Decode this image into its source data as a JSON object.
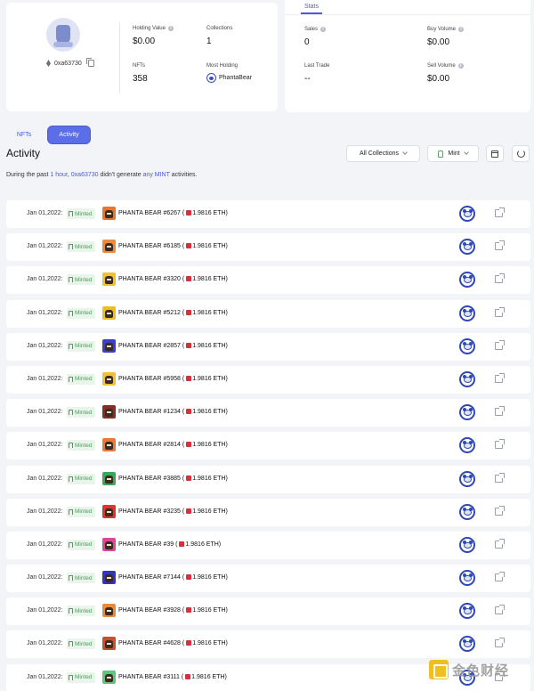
{
  "profile": {
    "address": "0xa63730",
    "holding_value_label": "Holding Value",
    "holding_value": "$0.00",
    "collections_label": "Collections",
    "collections": "1",
    "nfts_label": "NFTs",
    "nfts": "358",
    "most_holding_label": "Most Holding",
    "most_holding": "PhantaBear"
  },
  "stats": {
    "tab_label": "Stats",
    "sales_label": "Sales",
    "sales": "0",
    "buy_volume_label": "Buy Volume",
    "buy_volume": "$0.00",
    "last_trade_label": "Last Trade",
    "last_trade": "--",
    "sell_volume_label": "Sell Volume",
    "sell_volume": "$0.00"
  },
  "tabs": {
    "nfts": "NFTs",
    "activity": "Activity"
  },
  "section_title": "Activity",
  "filters": {
    "collections": "All Collections",
    "type": "Mint"
  },
  "notice": {
    "p1": "During the past ",
    "period": "1 hour",
    "p2": ", ",
    "address": "0xa63730",
    "p3": " didn't generate ",
    "p4": "any MINT",
    "p5": " activities."
  },
  "activities": [
    {
      "date": "Jan 01,2022:",
      "badge": "Minted",
      "name": "PHANTA BEAR #6267",
      "price_open": "(",
      "price": "1.9816 ETH)",
      "thumb_color": "#e8762c"
    },
    {
      "date": "Jan 01,2022:",
      "badge": "Minted",
      "name": "PHANTA BEAR #6185",
      "price_open": "(",
      "price": "1.9816 ETH)",
      "thumb_color": "#f08a3a"
    },
    {
      "date": "Jan 01,2022:",
      "badge": "Minted",
      "name": "PHANTA BEAR #3320",
      "price_open": "(",
      "price": "1.9816 ETH)",
      "thumb_color": "#f2c12e"
    },
    {
      "date": "Jan 01,2022:",
      "badge": "Minted",
      "name": "PHANTA BEAR #5212",
      "price_open": "(",
      "price": "1.9816 ETH)",
      "thumb_color": "#e8c02a"
    },
    {
      "date": "Jan 01,2022:",
      "badge": "Minted",
      "name": "PHANTA BEAR #2857",
      "price_open": "(",
      "price": "1.9816 ETH)",
      "thumb_color": "#3b3fcf"
    },
    {
      "date": "Jan 01,2022:",
      "badge": "Minted",
      "name": "PHANTA BEAR #5958",
      "price_open": "(",
      "price": "1.9816 ETH)",
      "thumb_color": "#f2c232"
    },
    {
      "date": "Jan 01,2022:",
      "badge": "Minted",
      "name": "PHANTA BEAR #1234",
      "price_open": "(",
      "price": "1.9816 ETH)",
      "thumb_color": "#8a2a2a"
    },
    {
      "date": "Jan 01,2022:",
      "badge": "Minted",
      "name": "PHANTA BEAR #2814",
      "price_open": "(",
      "price": "1.9816 ETH)",
      "thumb_color": "#e87a3c"
    },
    {
      "date": "Jan 01,2022:",
      "badge": "Minted",
      "name": "PHANTA BEAR #3885",
      "price_open": "(",
      "price": "1.9816 ETH)",
      "thumb_color": "#3aa85a"
    },
    {
      "date": "Jan 01,2022:",
      "badge": "Minted",
      "name": "PHANTA BEAR #3235",
      "price_open": "(",
      "price": "1.9816 ETH)",
      "thumb_color": "#d8362f"
    },
    {
      "date": "Jan 01,2022:",
      "badge": "Minted",
      "name": "PHANTA BEAR #39",
      "price_open": "(",
      "price": "1.9816 ETH)",
      "thumb_color": "#d8499a"
    },
    {
      "date": "Jan 01,2022:",
      "badge": "Minted",
      "name": "PHANTA BEAR #7144",
      "price_open": "(",
      "price": "1.9816 ETH)",
      "thumb_color": "#3035c8"
    },
    {
      "date": "Jan 01,2022:",
      "badge": "Minted",
      "name": "PHANTA BEAR #3928",
      "price_open": "(",
      "price": "1.9816 ETH)",
      "thumb_color": "#e98a3d"
    },
    {
      "date": "Jan 01,2022:",
      "badge": "Minted",
      "name": "PHANTA BEAR #4628",
      "price_open": "(",
      "price": "1.9816 ETH)",
      "thumb_color": "#c8502a"
    },
    {
      "date": "Jan 01,2022:",
      "badge": "Minted",
      "name": "PHANTA BEAR #3111",
      "price_open": "(",
      "price": "1.9816 ETH)",
      "thumb_color": "#5ac87a"
    }
  ],
  "watermark": {
    "text": "金色财经"
  },
  "colors": {
    "accent": "#5b6ee8",
    "minted_green": "#4a9d5a",
    "link_blue": "#4b5bd8"
  }
}
